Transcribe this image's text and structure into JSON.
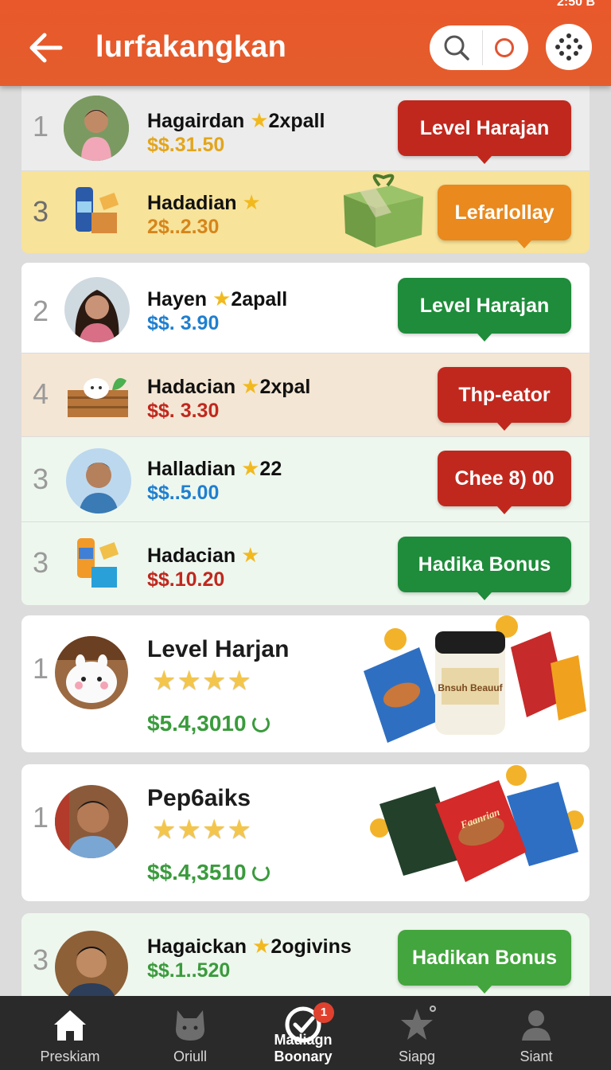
{
  "status": {
    "text": "2:50 B"
  },
  "header": {
    "title": "lurfakangkan"
  },
  "rows": [
    {
      "rank": "1",
      "name": "Hagairdan",
      "suffix": "2xpall",
      "price": "$$.31.50",
      "button": "Level Harajan"
    },
    {
      "rank": "3",
      "name": "Hadadian",
      "suffix": "",
      "price": "2$..2.30",
      "button": "Lefarlollay"
    },
    {
      "rank": "2",
      "name": "Hayen",
      "suffix": "2apall",
      "price": "$$. 3.90",
      "button": "Level Harajan"
    },
    {
      "rank": "4",
      "name": "Hadacian",
      "suffix": "2xpal",
      "price": "$$. 3.30",
      "button": "Thp-eator"
    },
    {
      "rank": "3",
      "name": "Halladian",
      "suffix": "22",
      "price": "$$..5.00",
      "button": "Chee 8) 00"
    },
    {
      "rank": "3",
      "name": "Hadacian",
      "suffix": "",
      "price": "$$.10.20",
      "button": "Hadika  Bonus"
    }
  ],
  "cards": [
    {
      "rank": "1",
      "name": "Level Harjan",
      "stars": "★★★★",
      "price": "$5.4,3010",
      "pack_label": "Bnsuh Beauuf"
    },
    {
      "rank": "1",
      "name": "Pep6aiks",
      "stars": "★★★★",
      "price": "$$.4,3510",
      "pack_label": "Faanrian"
    }
  ],
  "last_row": {
    "rank": "3",
    "name": "Hagaickan",
    "suffix": "2ogivins",
    "price": "$$.1..520",
    "button": "Hadikan Bonus"
  },
  "nav": [
    {
      "label": "Preskiam",
      "icon": "home-icon"
    },
    {
      "label": "Oriull",
      "icon": "pet-icon"
    },
    {
      "label": "Madiagn Boonary",
      "icon": "check-circle-icon",
      "badge": "1"
    },
    {
      "label": "Siapg",
      "icon": "star-icon"
    },
    {
      "label": "Siant",
      "icon": "person-icon"
    }
  ],
  "colors": {
    "header": "#e8582b",
    "red": "#c0281e",
    "green": "#1e8c3a",
    "orange": "#e9891e",
    "blue_price": "#1f7fd0"
  }
}
